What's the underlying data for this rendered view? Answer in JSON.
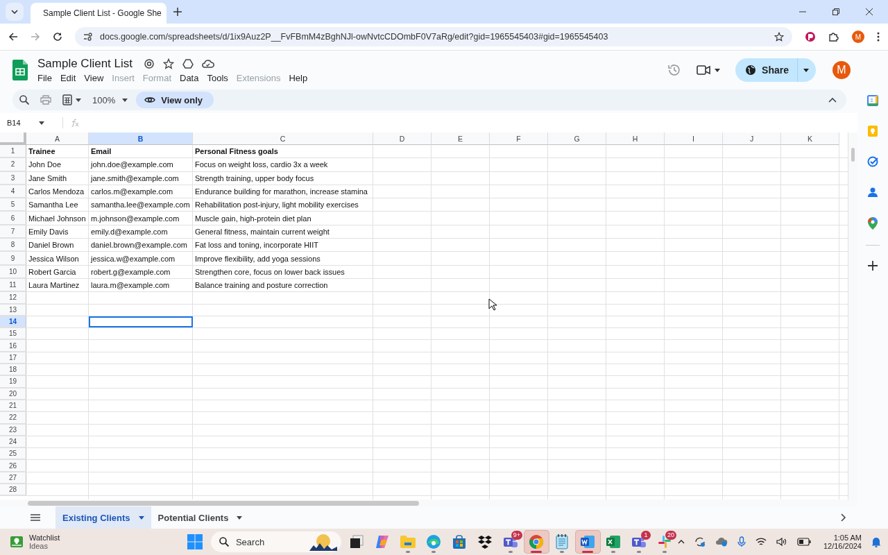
{
  "browser": {
    "tab_title": "Sample Client List - Google She",
    "url": "docs.google.com/spreadsheets/d/1ix9Auz2P__FvFBmM4zBghNJl-owNvtcCDOmbF0V7aRg/edit?gid=1965545403#gid=1965545403",
    "profile": "M"
  },
  "document": {
    "title": "Sample Client List",
    "share": "Share",
    "avatar": "M",
    "menu": [
      {
        "label": "File",
        "disabled": false
      },
      {
        "label": "Edit",
        "disabled": false
      },
      {
        "label": "View",
        "disabled": false
      },
      {
        "label": "Insert",
        "disabled": true
      },
      {
        "label": "Format",
        "disabled": true
      },
      {
        "label": "Data",
        "disabled": false
      },
      {
        "label": "Tools",
        "disabled": false
      },
      {
        "label": "Extensions",
        "disabled": true
      },
      {
        "label": "Help",
        "disabled": false
      }
    ]
  },
  "toolbar": {
    "zoom": "100%",
    "mode": "View only"
  },
  "formula_bar": {
    "cell_ref": "B14"
  },
  "grid": {
    "columns": [
      {
        "label": "A",
        "selected": false
      },
      {
        "label": "B",
        "selected": true
      },
      {
        "label": "C",
        "selected": false
      },
      {
        "label": "D",
        "selected": false
      },
      {
        "label": "E",
        "selected": false
      },
      {
        "label": "F",
        "selected": false
      },
      {
        "label": "G",
        "selected": false
      },
      {
        "label": "H",
        "selected": false
      },
      {
        "label": "I",
        "selected": false
      },
      {
        "label": "J",
        "selected": false
      },
      {
        "label": "K",
        "selected": false
      }
    ],
    "rows": [
      {
        "number": "1",
        "selected": false,
        "kind": "header",
        "cells": [
          "Trainee",
          "Email",
          "Personal Fitness goals"
        ]
      },
      {
        "number": "2",
        "selected": false,
        "kind": "data",
        "cells": [
          "John Doe",
          "john.doe@example.com",
          "Focus on weight loss, cardio 3x a week"
        ]
      },
      {
        "number": "3",
        "selected": false,
        "kind": "data",
        "cells": [
          "Jane Smith",
          "jane.smith@example.com",
          "Strength training, upper body focus"
        ]
      },
      {
        "number": "4",
        "selected": false,
        "kind": "data",
        "cells": [
          "Carlos Mendoza",
          "carlos.m@example.com",
          "Endurance building for marathon, increase stamina"
        ]
      },
      {
        "number": "5",
        "selected": false,
        "kind": "data",
        "cells": [
          "Samantha Lee",
          "samantha.lee@example.com",
          "Rehabilitation post-injury, light mobility exercises"
        ]
      },
      {
        "number": "6",
        "selected": false,
        "kind": "data",
        "cells": [
          "Michael Johnson",
          "m.johnson@example.com",
          "Muscle gain, high-protein diet plan"
        ]
      },
      {
        "number": "7",
        "selected": false,
        "kind": "data",
        "cells": [
          "Emily Davis",
          "emily.d@example.com",
          "General fitness, maintain current weight"
        ]
      },
      {
        "number": "8",
        "selected": false,
        "kind": "data",
        "cells": [
          "Daniel Brown",
          "daniel.brown@example.com",
          "Fat loss and toning, incorporate HIIT"
        ]
      },
      {
        "number": "9",
        "selected": false,
        "kind": "data",
        "cells": [
          "Jessica Wilson",
          "jessica.w@example.com",
          "Improve flexibility, add yoga sessions"
        ]
      },
      {
        "number": "10",
        "selected": false,
        "kind": "data",
        "cells": [
          "Robert Garcia",
          "robert.g@example.com",
          "Strengthen core, focus on lower back issues"
        ]
      },
      {
        "number": "11",
        "selected": false,
        "kind": "data",
        "cells": [
          "Laura Martinez",
          "laura.m@example.com",
          "Balance training and posture correction"
        ]
      },
      {
        "number": "12",
        "selected": false,
        "cells": []
      },
      {
        "number": "13",
        "selected": false,
        "cells": []
      },
      {
        "number": "14",
        "selected": true,
        "cells": []
      },
      {
        "number": "15",
        "selected": false,
        "cells": []
      },
      {
        "number": "16",
        "selected": false,
        "cells": []
      },
      {
        "number": "17",
        "selected": false,
        "cells": []
      },
      {
        "number": "18",
        "selected": false,
        "cells": []
      },
      {
        "number": "19",
        "selected": false,
        "cells": []
      },
      {
        "number": "20",
        "selected": false,
        "cells": []
      },
      {
        "number": "21",
        "selected": false,
        "cells": []
      },
      {
        "number": "22",
        "selected": false,
        "cells": []
      },
      {
        "number": "23",
        "selected": false,
        "cells": []
      },
      {
        "number": "24",
        "selected": false,
        "cells": []
      },
      {
        "number": "25",
        "selected": false,
        "cells": []
      },
      {
        "number": "26",
        "selected": false,
        "cells": []
      },
      {
        "number": "27",
        "selected": false,
        "cells": []
      },
      {
        "number": "28",
        "selected": false,
        "cells": []
      }
    ]
  },
  "sheet_tabs": [
    {
      "label": "Existing Clients",
      "selected": true
    },
    {
      "label": "Potential Clients",
      "selected": false
    }
  ],
  "taskbar": {
    "widget": {
      "title": "Watchlist",
      "subtitle": "Ideas"
    },
    "search": {
      "placeholder": "Search"
    },
    "apps": [
      {
        "kind": "start",
        "selected": false,
        "open": false
      },
      {
        "kind": "taskview",
        "selected": false,
        "open": false
      },
      {
        "kind": "copilot",
        "selected": false,
        "open": false
      },
      {
        "kind": "explorer",
        "selected": false,
        "open": true
      },
      {
        "kind": "edge",
        "selected": false,
        "open": true
      },
      {
        "kind": "store",
        "selected": false,
        "open": false
      },
      {
        "kind": "dropbox",
        "selected": false,
        "open": false
      },
      {
        "kind": "teams",
        "selected": false,
        "open": true,
        "badge": "9+"
      },
      {
        "kind": "chrome",
        "selected": true,
        "open": true
      },
      {
        "kind": "notepad",
        "selected": false,
        "open": true
      },
      {
        "kind": "word",
        "selected": true,
        "open": true
      },
      {
        "kind": "excel",
        "selected": false,
        "open": true
      },
      {
        "kind": "teams",
        "selected": false,
        "open": true,
        "badge": "1"
      },
      {
        "kind": "slack",
        "selected": false,
        "open": true,
        "badge": "20"
      }
    ],
    "time": "1:05 AM",
    "date": "12/16/2024"
  }
}
